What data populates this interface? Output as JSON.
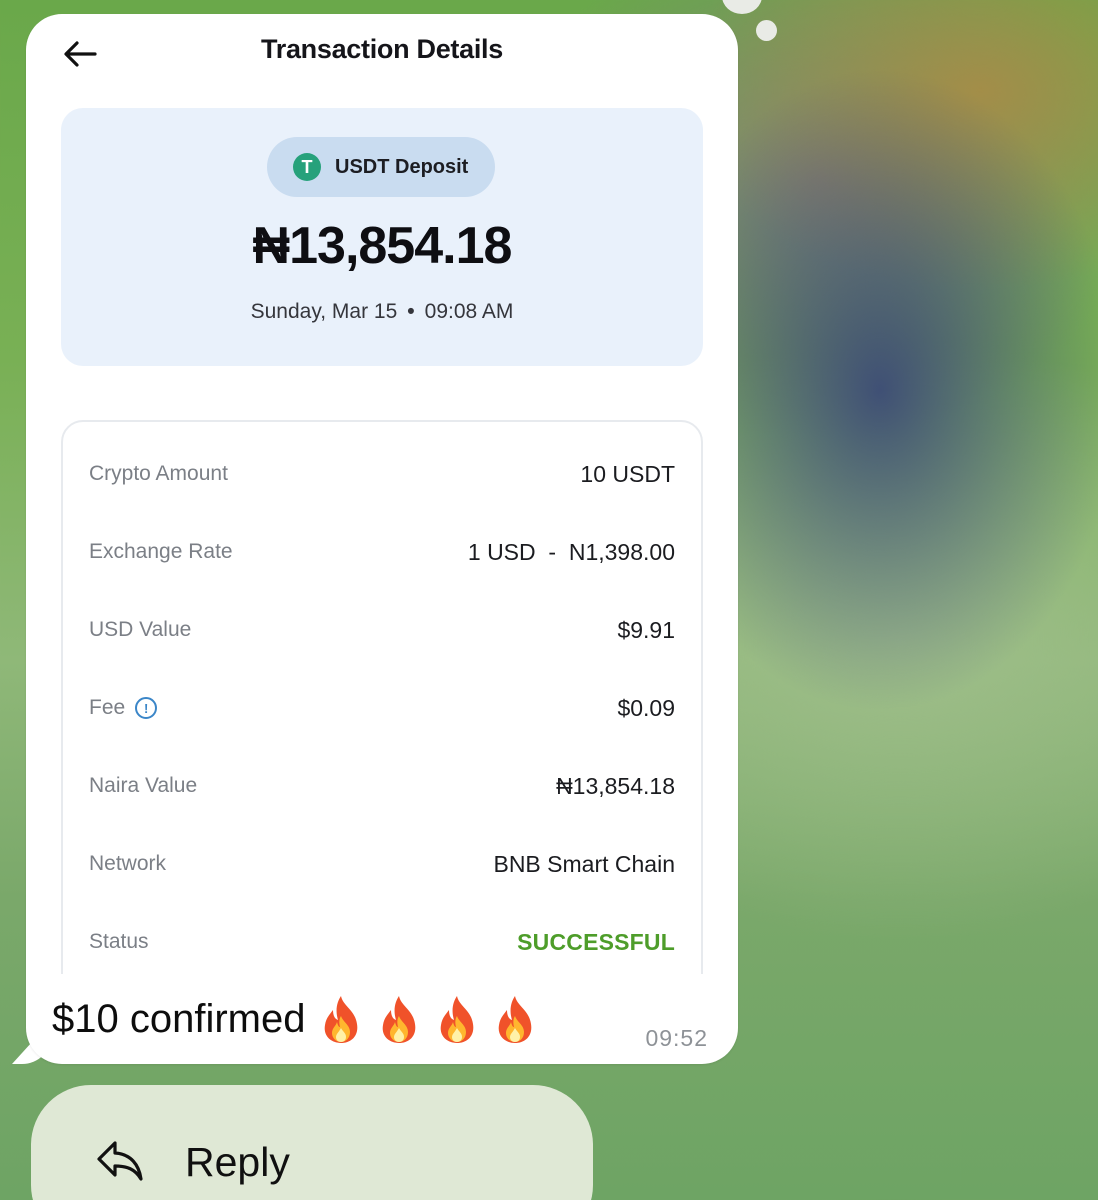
{
  "chat": {
    "message_text": "$10 confirmed",
    "message_time": "09:52",
    "reply_label": "Reply",
    "fire_emoji": "🔥",
    "fire_count": 4
  },
  "screenshot": {
    "title": "Transaction Details",
    "badge_label": "USDT Deposit",
    "badge_icon_letter": "T",
    "amount": "₦13,854.18",
    "date": "Sunday, Mar 15",
    "time": "09:08 AM",
    "date_separator": "•",
    "rows": [
      {
        "label": "Crypto Amount",
        "value": "10 USDT"
      },
      {
        "label": "Exchange Rate",
        "value": "1 USD  -  N1,398.00"
      },
      {
        "label": "USD Value",
        "value": "$9.91"
      },
      {
        "label": "Fee",
        "value": "$0.09",
        "has_info_icon": true
      },
      {
        "label": "Naira Value",
        "value": "₦13,854.18"
      },
      {
        "label": "Network",
        "value": "BNB Smart Chain"
      },
      {
        "label": "Status",
        "value": "SUCCESSFUL"
      }
    ]
  },
  "colors": {
    "success": "#4e9d2a",
    "tether": "#26a17b",
    "info": "#3b86c8",
    "hero_bg": "#e9f1fb",
    "pill_bg": "#c9dcf0"
  },
  "icons": {
    "back": "arrow-left-icon",
    "badge": "tether-icon",
    "fee_info": "info-icon",
    "reaction": "fire-icon",
    "reply": "reply-icon"
  }
}
